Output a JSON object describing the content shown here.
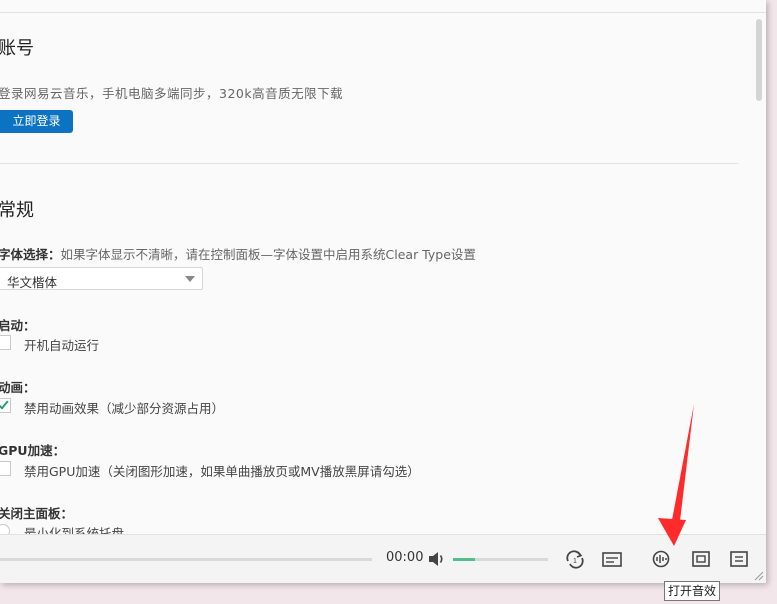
{
  "account": {
    "title": "账号",
    "subtitle": "登录网易云音乐，手机电脑多端同步，320k高音质无限下载",
    "login_button": "立即登录"
  },
  "general": {
    "title": "常规",
    "font": {
      "label": "字体选择：",
      "description": "如果字体显示不清晰，请在控制面板—字体设置中启用系统Clear Type设置",
      "selected": "华文楷体"
    },
    "startup": {
      "label": "启动：",
      "option": "开机自动运行",
      "checked": false
    },
    "animation": {
      "label": "动画：",
      "option": "禁用动画效果（减少部分资源占用）",
      "checked": true
    },
    "gpu": {
      "label": "GPU加速：",
      "option": "禁用GPU加速（关闭图形加速，如果单曲播放页或MV播放黑屏请勾选）",
      "checked": false
    },
    "close_panel": {
      "label": "关闭主面板：",
      "option": "最小化到系统托盘"
    }
  },
  "player": {
    "time": "00:00",
    "volume_fraction": 0.23,
    "icons": [
      "loop-icon",
      "lyrics-icon",
      "sound-effect-icon",
      "playlist-icon",
      "queue-icon"
    ]
  },
  "tooltip": "打开音效",
  "colors": {
    "accent_blue": "#0c73c2",
    "volume_green": "#4fc08d",
    "check_green": "#22a06b",
    "annotation_red": "#ff2a2a"
  }
}
